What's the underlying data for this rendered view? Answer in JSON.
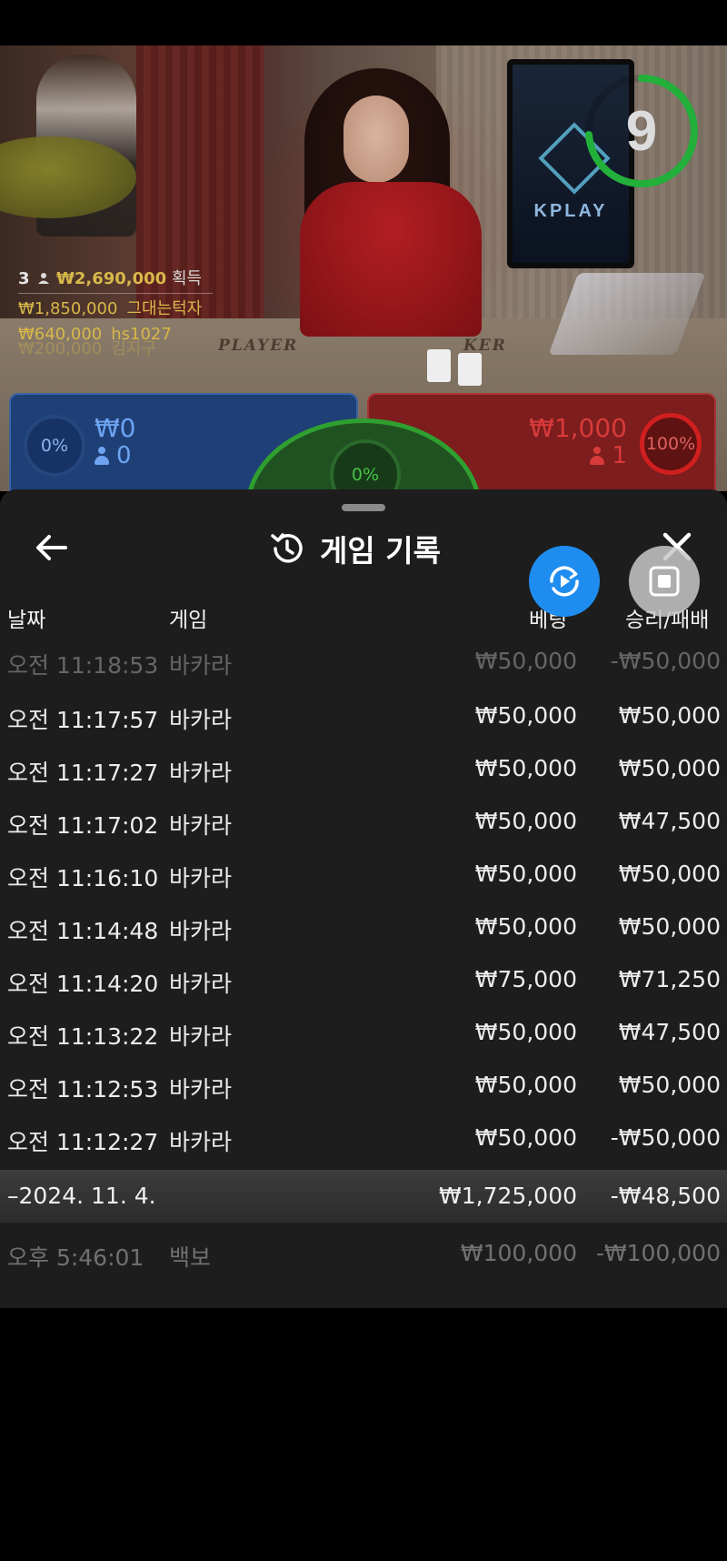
{
  "video": {
    "timer": "9",
    "monitor_brand": "KPLAY",
    "table_labels": {
      "player": "PLAYER",
      "banker": "KER"
    }
  },
  "winners": {
    "head": {
      "count": "3",
      "amount": "₩2,690,000",
      "label": "획득"
    },
    "rows": [
      {
        "amount": "₩1,850,000",
        "name": "그대는턱자"
      },
      {
        "amount": "₩640,000",
        "name": "hs1027"
      },
      {
        "amount": "₩200,000",
        "name": "김지구"
      }
    ]
  },
  "bets": {
    "player": {
      "percent": "0%",
      "amount": "₩0",
      "count": "0"
    },
    "tie": {
      "percent": "0%"
    },
    "banker": {
      "percent": "100%",
      "amount": "₩1,000",
      "count": "1"
    }
  },
  "sheet": {
    "title": "게임 기록",
    "columns": {
      "date": "날짜",
      "game": "게임",
      "bet": "베팅",
      "result": "승리/패배"
    },
    "rows": [
      {
        "time": "오전 11:18:53",
        "game": "바카라",
        "bet": "₩50,000",
        "result": "-₩50,000"
      },
      {
        "time": "오전 11:17:57",
        "game": "바카라",
        "bet": "₩50,000",
        "result": "₩50,000"
      },
      {
        "time": "오전 11:17:27",
        "game": "바카라",
        "bet": "₩50,000",
        "result": "₩50,000"
      },
      {
        "time": "오전 11:17:02",
        "game": "바카라",
        "bet": "₩50,000",
        "result": "₩47,500"
      },
      {
        "time": "오전 11:16:10",
        "game": "바카라",
        "bet": "₩50,000",
        "result": "₩50,000"
      },
      {
        "time": "오전 11:14:48",
        "game": "바카라",
        "bet": "₩50,000",
        "result": "₩50,000"
      },
      {
        "time": "오전 11:14:20",
        "game": "바카라",
        "bet": "₩75,000",
        "result": "₩71,250"
      },
      {
        "time": "오전 11:13:22",
        "game": "바카라",
        "bet": "₩50,000",
        "result": "₩47,500"
      },
      {
        "time": "오전 11:12:53",
        "game": "바카라",
        "bet": "₩50,000",
        "result": "₩50,000"
      },
      {
        "time": "오전 11:12:27",
        "game": "바카라",
        "bet": "₩50,000",
        "result": "-₩50,000"
      }
    ],
    "day_summary": {
      "date": "–2024. 11. 4.",
      "bet": "₩1,725,000",
      "result": "-₩48,500"
    },
    "tail_row": {
      "time": "오후 5:46:01",
      "game": "백보",
      "bet": "₩100,000",
      "result": "-₩100,000"
    }
  },
  "colors": {
    "accent_blue": "#1f8df0",
    "timer_green": "#22b03a",
    "gold": "#d7b84a",
    "player_blue": "#1f3f77",
    "banker_red": "#7d1d1d"
  },
  "icons": [
    "back-arrow-icon",
    "history-icon",
    "close-icon",
    "replay-icon",
    "stop-icon",
    "person-icon"
  ]
}
